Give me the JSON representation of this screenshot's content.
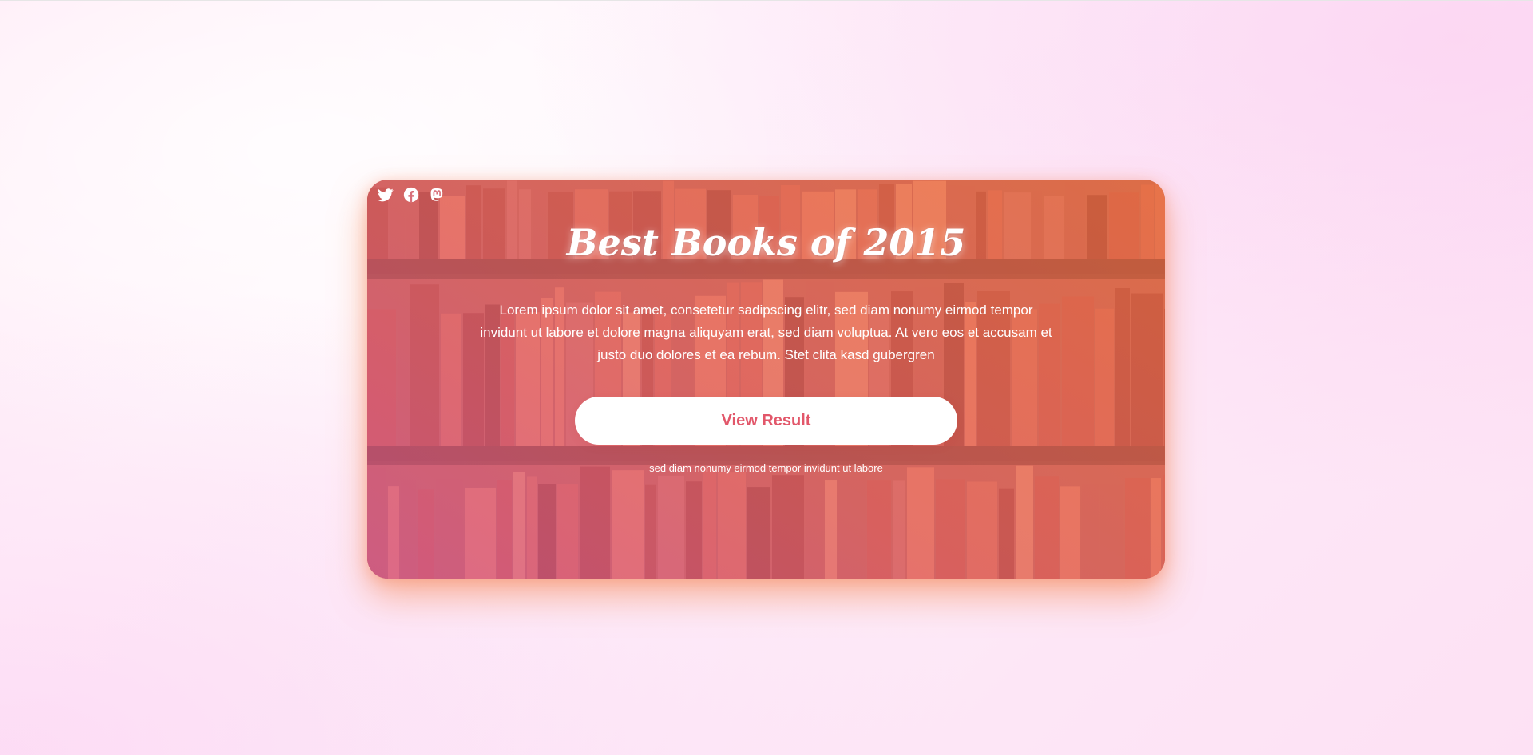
{
  "card": {
    "title": "Best Books of 2015",
    "description": "Lorem ipsum dolor sit amet, consetetur sadipscing elitr, sed diam nonumy eirmod tempor invidunt ut labore et dolore magna aliquyam erat, sed diam voluptua. At vero eos et accusam et justo duo dolores et ea rebum. Stet clita kasd gubergren",
    "cta_label": "View Result",
    "note": "sed diam nonumy eirmod tempor invidunt ut labore"
  },
  "social": {
    "icons": [
      "twitter-icon",
      "facebook-icon",
      "mastodon-icon"
    ]
  },
  "colors": {
    "accent": "#e2576a",
    "overlay_pink": "#da5fa5",
    "overlay_orange": "#f47a46",
    "page_bg": "#fff0fa"
  }
}
